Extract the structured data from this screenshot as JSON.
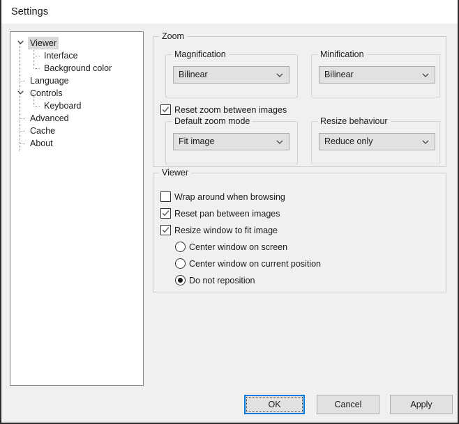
{
  "window": {
    "title": "Settings"
  },
  "tree": {
    "items": [
      {
        "label": "Viewer",
        "level": 0,
        "expander": "chevron-down-icon",
        "selected": true
      },
      {
        "label": "Interface",
        "level": 1,
        "expander": "none",
        "selected": false
      },
      {
        "label": "Background color",
        "level": 1,
        "expander": "none",
        "selected": false
      },
      {
        "label": "Language",
        "level": 0,
        "expander": "none",
        "selected": false
      },
      {
        "label": "Controls",
        "level": 0,
        "expander": "chevron-down-icon",
        "selected": false
      },
      {
        "label": "Keyboard",
        "level": 1,
        "expander": "none",
        "selected": false
      },
      {
        "label": "Advanced",
        "level": 0,
        "expander": "none",
        "selected": false
      },
      {
        "label": "Cache",
        "level": 0,
        "expander": "none",
        "selected": false
      },
      {
        "label": "About",
        "level": 0,
        "expander": "none",
        "selected": false
      }
    ]
  },
  "zoom_group": {
    "title": "Zoom",
    "magnification": {
      "title": "Magnification",
      "value": "Bilinear",
      "options": [
        "Bilinear"
      ]
    },
    "minification": {
      "title": "Minification",
      "value": "Bilinear",
      "options": [
        "Bilinear"
      ]
    },
    "reset_zoom": {
      "label": "Reset zoom between images",
      "checked": true
    },
    "default_zoom_mode": {
      "title": "Default zoom mode",
      "value": "Fit image",
      "options": [
        "Fit image"
      ]
    },
    "resize_behaviour": {
      "title": "Resize behaviour",
      "value": "Reduce only",
      "options": [
        "Reduce only"
      ]
    }
  },
  "viewer_group": {
    "title": "Viewer",
    "checkboxes": [
      {
        "label": "Wrap around when browsing",
        "checked": false
      },
      {
        "label": "Reset pan between images",
        "checked": true
      },
      {
        "label": "Resize window to fit image",
        "checked": true
      }
    ],
    "radios": [
      {
        "label": "Center window on screen",
        "selected": false
      },
      {
        "label": "Center window on current position",
        "selected": false
      },
      {
        "label": "Do not reposition",
        "selected": true
      }
    ]
  },
  "buttons": {
    "ok": "OK",
    "cancel": "Cancel",
    "apply": "Apply"
  },
  "colors": {
    "dialog_background": "#f0f0f0",
    "accent_focus": "#0078d7",
    "selection_highlight": "#d9d9d9",
    "control_face": "#e1e1e1",
    "control_border": "#adadad",
    "title_bar": "#ffffff"
  }
}
